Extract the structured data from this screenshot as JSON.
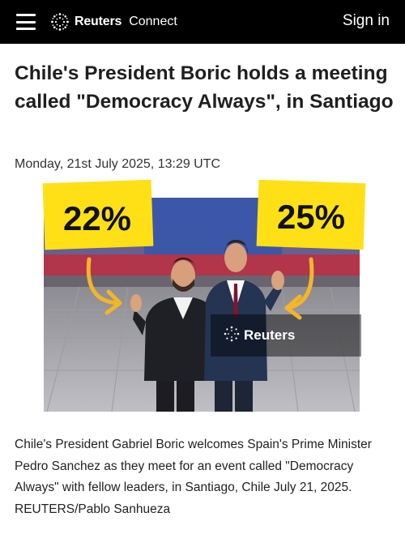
{
  "header": {
    "brand_name": "Reuters",
    "brand_sub": "Connect",
    "signin_label": "Sign in"
  },
  "article": {
    "headline": "Chile's President Boric holds a meeting called \"Democracy Always\", in Santiago",
    "dateline": "Monday, 21st July 2025, 13:29 UTC",
    "caption": "Chile's President Gabriel Boric welcomes Spain's Prime Minister Pedro Sanchez as they meet for an event called \"Democracy Always\" with fellow leaders, in Santiago, Chile July 21, 2025. REUTERS/Pablo Sanhueza"
  },
  "photo": {
    "left_percent_label": "22%",
    "right_percent_label": "25%",
    "watermark": "Reuters"
  },
  "colors": {
    "topbar_bg": "#000000",
    "sticker_yellow": "#ffe017",
    "arrow_orange": "#f3b52a"
  },
  "icons": {
    "menu": "hamburger-icon",
    "logo": "reuters-logo-icon"
  }
}
